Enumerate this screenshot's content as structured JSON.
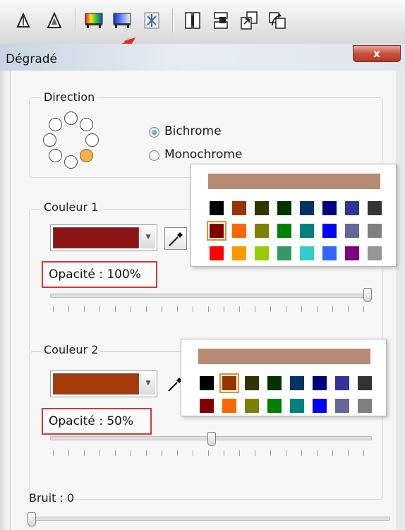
{
  "window": {
    "title": "Dégradé",
    "close_label": "x"
  },
  "toolbar": {
    "icons": [
      "up-triangle-icon",
      "up-triangle-outline-icon",
      "gradient-color-icon",
      "gradient-blue-icon",
      "pattern-icon",
      "page-icon",
      "align-icon",
      "transfer-icon",
      "swap-icon"
    ]
  },
  "direction": {
    "label": "Direction",
    "selected_position": "bottom-right",
    "options": [
      {
        "label": "Bichrome",
        "selected": true
      },
      {
        "label": "Monochrome",
        "selected": false
      }
    ]
  },
  "color1": {
    "label": "Couleur 1",
    "swatch": "#8c1414",
    "opacity_label": "Opacité : 100%",
    "opacity_value": 100,
    "palette_bar_color": "#b68a73",
    "palette_rows": [
      [
        "#000000",
        "#993300",
        "#333300",
        "#003300",
        "#003366",
        "#000080",
        "#333399",
        "#333333"
      ],
      [
        "#800000",
        "#ff6600",
        "#808000",
        "#008000",
        "#008080",
        "#0000ff",
        "#666699",
        "#808080"
      ],
      [
        "#ff0000",
        "#ff9900",
        "#99cc00",
        "#339966",
        "#33cccc",
        "#3366ff",
        "#800080",
        "#969696"
      ]
    ],
    "palette_selected": [
      1,
      0
    ]
  },
  "color2": {
    "label": "Couleur 2",
    "swatch": "#a53a0a",
    "opacity_label": "Opacité : 50%",
    "opacity_value": 50,
    "palette_bar_color": "#b68a73",
    "palette_rows": [
      [
        "#000000",
        "#993300",
        "#333300",
        "#003300",
        "#003366",
        "#000080",
        "#333399",
        "#333333"
      ],
      [
        "#800000",
        "#ff6600",
        "#808000",
        "#008000",
        "#008080",
        "#0000ff",
        "#666699",
        "#808080"
      ]
    ],
    "palette_selected": [
      0,
      1
    ]
  },
  "noise": {
    "label": "Bruit : 0",
    "value": 0
  },
  "accent_colors": {
    "highlight_box": "#d2383b",
    "arrow": "#e42b2b",
    "selected_cell": "#d79628",
    "selected_direction": "#f2b04a"
  }
}
